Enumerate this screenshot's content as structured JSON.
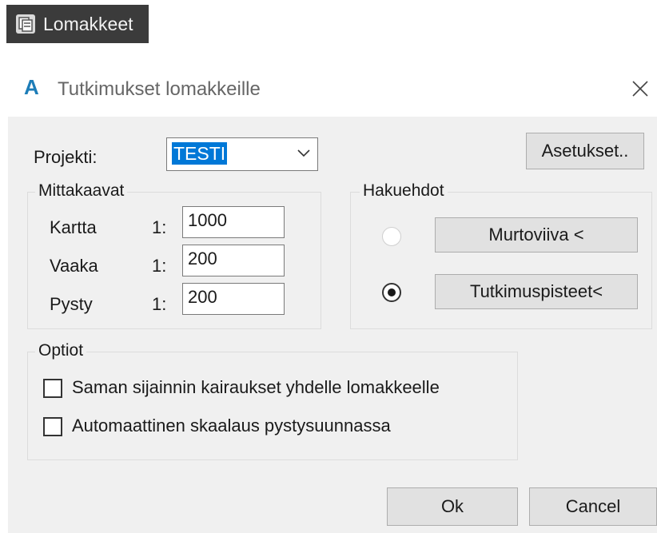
{
  "ribbon": {
    "label": "Lomakkeet",
    "icon": "forms-icon"
  },
  "dialog": {
    "title": "Tutkimukset lomakkeille",
    "app_icon": "A",
    "close_glyph": "✕"
  },
  "projekti": {
    "label": "Projekti:",
    "value": "TESTI",
    "settings_button": "Asetukset.."
  },
  "mittakaavat": {
    "title": "Mittakaavat",
    "rows": [
      {
        "label": "Kartta",
        "prefix": "1:",
        "value": "1000"
      },
      {
        "label": "Vaaka",
        "prefix": "1:",
        "value": "200"
      },
      {
        "label": "Pysty",
        "prefix": "1:",
        "value": "200"
      }
    ]
  },
  "hakuehdot": {
    "title": "Hakuehdot",
    "options": [
      {
        "button": "Murtoviiva <",
        "selected": false
      },
      {
        "button": "Tutkimuspisteet<",
        "selected": true
      }
    ]
  },
  "optiot": {
    "title": "Optiot",
    "checkboxes": [
      {
        "label": "Saman sijainnin kairaukset yhdelle lomakkeelle",
        "checked": false
      },
      {
        "label": "Automaattinen skaalaus pystysuunnassa",
        "checked": false
      }
    ]
  },
  "footer": {
    "ok": "Ok",
    "cancel": "Cancel"
  }
}
